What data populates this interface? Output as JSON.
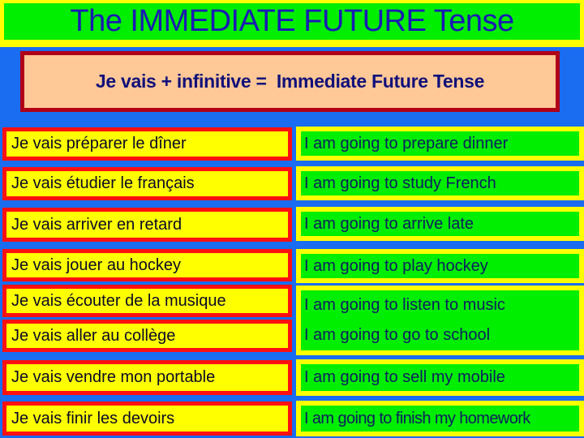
{
  "header": {
    "title": "The IMMEDIATE FUTURE Tense"
  },
  "rule": {
    "text": "Je vais + infinitive =  Immediate Future Tense"
  },
  "rows": [
    {
      "french": "Je vais préparer le dîner",
      "english": "I am going to prepare dinner"
    },
    {
      "french": "Je vais étudier le français",
      "english": "I am going to study French"
    },
    {
      "french": "Je vais arriver en retard",
      "english": "I am going to arrive late"
    },
    {
      "french": "Je vais jouer au hockey",
      "english": "I am going to play hockey"
    },
    {
      "french": "Je vais écouter de la musique",
      "english": "I am going to listen to music"
    },
    {
      "french": "Je vais aller au collège",
      "english": "I am going to go to school"
    },
    {
      "french": "Je vais vendre mon portable",
      "english": "I am going to sell my mobile"
    },
    {
      "french": "Je vais finir les devoirs",
      "english": "I am going to finish my homework"
    }
  ],
  "colors": {
    "background": "#1a6cf0",
    "header_border": "#ffff00",
    "header_fill": "#00ee00",
    "title_text": "#1a1ab4",
    "rule_border": "#b00018",
    "rule_fill": "#ffc896",
    "french_border": "#ff1010",
    "french_fill": "#ffff00",
    "english_border": "#ffff00",
    "english_fill": "#00ee00"
  }
}
